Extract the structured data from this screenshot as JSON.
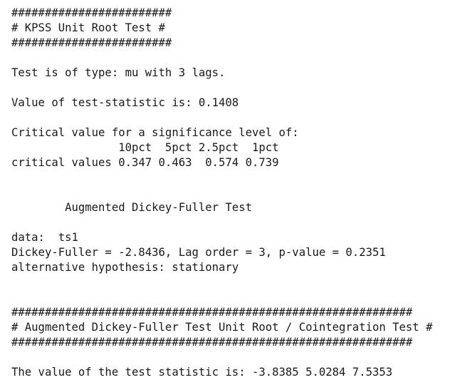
{
  "console": {
    "lines": [
      "########################",
      "# KPSS Unit Root Test #",
      "########################",
      "",
      "Test is of type: mu with 3 lags.",
      "",
      "Value of test-statistic is: 0.1408",
      "",
      "Critical value for a significance level of:",
      "                10pct  5pct 2.5pct  1pct",
      "critical values 0.347 0.463  0.574 0.739",
      "",
      "",
      "        Augmented Dickey-Fuller Test",
      "",
      "data:  ts1",
      "Dickey-Fuller = -2.8436, Lag order = 3, p-value = 0.2351",
      "alternative hypothesis: stationary",
      "",
      "",
      "############################################################",
      "# Augmented Dickey-Fuller Test Unit Root / Cointegration Test #",
      "############################################################",
      "",
      "The value of the test statistic is: -3.8385 5.0284 7.5353"
    ]
  }
}
